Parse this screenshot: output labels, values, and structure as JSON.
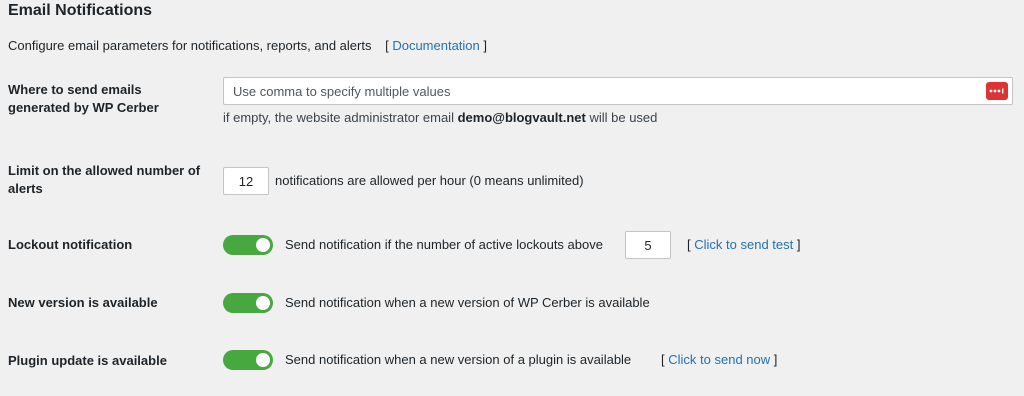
{
  "header": {
    "title": "Email Notifications",
    "description": "Configure email parameters for notifications, reports, and alerts",
    "doc_open": "[",
    "doc_link": "Documentation",
    "doc_close": "]"
  },
  "email": {
    "label_line1": "Where to send emails",
    "label_line2": "generated by WP Cerber",
    "placeholder": "Use comma to specify multiple values",
    "value": "",
    "password_manager_icon": "dots-icon",
    "hint_prefix": "if empty, the website administrator email",
    "hint_email": "demo@blogvault.net",
    "hint_suffix": "will be used"
  },
  "alerts_limit": {
    "label_line1": "Limit on the allowed number of",
    "label_line2": "alerts",
    "value": "12",
    "text": "notifications are allowed per hour (0 means unlimited)"
  },
  "lockout": {
    "label": "Lockout notification",
    "enabled": true,
    "text": "Send notification if the number of active lockouts above",
    "value": "5",
    "action_open": "[",
    "action_link": "Click to send test",
    "action_close": "]"
  },
  "new_version": {
    "label": "New version is available",
    "enabled": true,
    "text": "Send notification when a new version of WP Cerber is available"
  },
  "plugin_update": {
    "label": "Plugin update is available",
    "enabled": true,
    "text": "Send notification when a new version of a plugin is available",
    "action_open": "[",
    "action_link": "Click to send now",
    "action_close": "]"
  },
  "colors": {
    "toggle_on": "#46a83f",
    "link": "#2271b1",
    "password_icon": "#dd3333"
  }
}
